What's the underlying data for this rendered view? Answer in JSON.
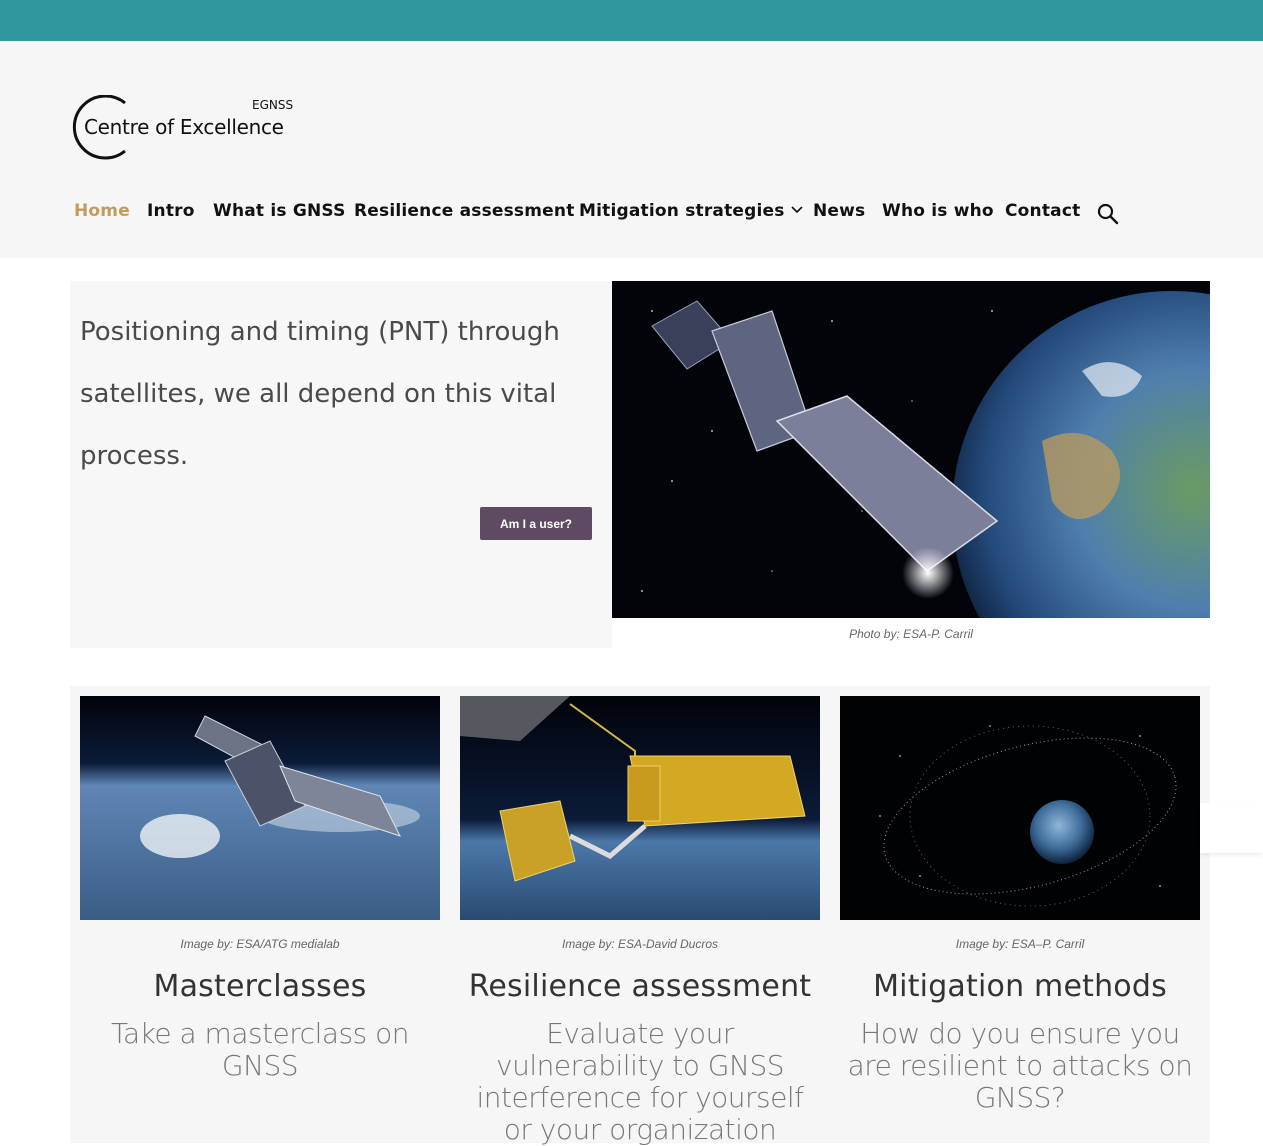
{
  "brand": {
    "egnss": "EGNSS",
    "title": "Centre of Excellence"
  },
  "nav": {
    "items": [
      {
        "label": "Home",
        "active": true
      },
      {
        "label": "Intro"
      },
      {
        "label": "What is GNSS"
      },
      {
        "label": "Resilience assessment"
      },
      {
        "label": "Mitigation strategies",
        "has_dropdown": true
      },
      {
        "label": "News"
      },
      {
        "label": "Who is who"
      },
      {
        "label": "Contact"
      }
    ],
    "search_icon": "search-icon"
  },
  "hero": {
    "text": "Positioning and timing (PNT) through satellites, we all depend on this vital process.",
    "button": "Am I a user?",
    "caption": "Photo by: ESA-P. Carril"
  },
  "cards": [
    {
      "caption": "Image by: ESA/ATG medialab",
      "title": "Masterclasses",
      "desc": "Take a masterclass on GNSS"
    },
    {
      "caption": "Image by: ESA-David Ducros",
      "title": "Resilience assessment",
      "desc": "Evaluate your vulnerability to GNSS interference for yourself or your organization"
    },
    {
      "caption": "Image by: ESA–P. Carril",
      "title": "Mitigation methods",
      "desc": "How do you ensure you are resilient to attacks on GNSS?"
    }
  ],
  "colors": {
    "topbar": "#2f989f",
    "nav_active": "#c39b5f",
    "button": "#5e4a62"
  }
}
